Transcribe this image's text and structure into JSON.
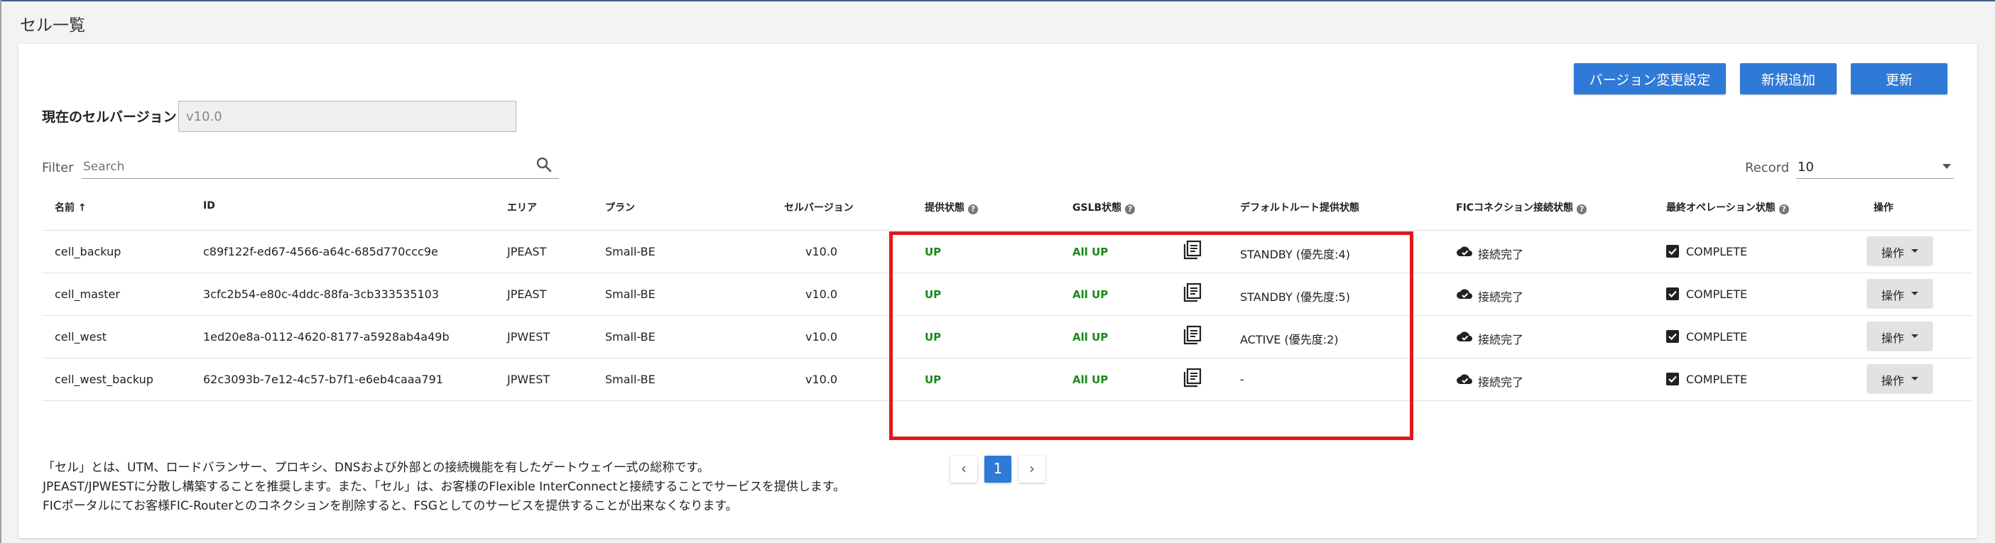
{
  "page": {
    "title": "セル一覧"
  },
  "toolbar": {
    "version_settings_label": "バージョン変更設定",
    "add_label": "新規追加",
    "refresh_label": "更新"
  },
  "version": {
    "label": "現在のセルバージョン",
    "value": "v10.0"
  },
  "filter": {
    "label": "Filter",
    "placeholder": "Search"
  },
  "record": {
    "label": "Record",
    "value": "10"
  },
  "columns": {
    "name": "名前 ↑",
    "id": "ID",
    "area": "エリア",
    "plan": "プラン",
    "cell_version": "セルバージョン",
    "provide_status": "提供状態",
    "gslb_status": "GSLB状態",
    "default_route": "デフォルトルート提供状態",
    "fic_status": "FICコネクション接続状態",
    "last_operation": "最終オペレーション状態",
    "operation": "操作"
  },
  "rows": [
    {
      "name": "cell_backup",
      "id": "c89f122f-ed67-4566-a64c-685d770ccc9e",
      "area": "JPEAST",
      "plan": "Small-BE",
      "version": "v10.0",
      "provide": "UP",
      "gslb": "All UP",
      "default_route": "STANDBY (優先度:4)",
      "fic": "接続完了",
      "last_op": "COMPLETE",
      "op_label": "操作"
    },
    {
      "name": "cell_master",
      "id": "3cfc2b54-e80c-4ddc-88fa-3cb333535103",
      "area": "JPEAST",
      "plan": "Small-BE",
      "version": "v10.0",
      "provide": "UP",
      "gslb": "All UP",
      "default_route": "STANDBY (優先度:5)",
      "fic": "接続完了",
      "last_op": "COMPLETE",
      "op_label": "操作"
    },
    {
      "name": "cell_west",
      "id": "1ed20e8a-0112-4620-8177-a5928ab4a49b",
      "area": "JPWEST",
      "plan": "Small-BE",
      "version": "v10.0",
      "provide": "UP",
      "gslb": "All UP",
      "default_route": "ACTIVE (優先度:2)",
      "fic": "接続完了",
      "last_op": "COMPLETE",
      "op_label": "操作"
    },
    {
      "name": "cell_west_backup",
      "id": "62c3093b-7e12-4c57-b7f1-e6eb4caaa791",
      "area": "JPWEST",
      "plan": "Small-BE",
      "version": "v10.0",
      "provide": "UP",
      "gslb": "All UP",
      "default_route": "-",
      "fic": "接続完了",
      "last_op": "COMPLETE",
      "op_label": "操作"
    }
  ],
  "pagination": {
    "prev": "‹",
    "current": "1",
    "next": "›"
  },
  "footer": {
    "line1": "「セル」とは、UTM、ロードバランサー、プロキシ、DNSおよび外部との接続機能を有したゲートウェイ一式の総称です。",
    "line2": "JPEAST/JPWESTに分散し構築することを推奨します。また、「セル」は、お客様のFlexible InterConnectと接続することでサービスを提供します。",
    "line3": "FICポータルにてお客様FIC-Routerとのコネクションを削除すると、FSGとしてのサービスを提供することが出来なくなります。"
  },
  "colors": {
    "accent": "#2f7ad6",
    "status_up": "#1a8a1a",
    "highlight": "#e01a1a"
  }
}
